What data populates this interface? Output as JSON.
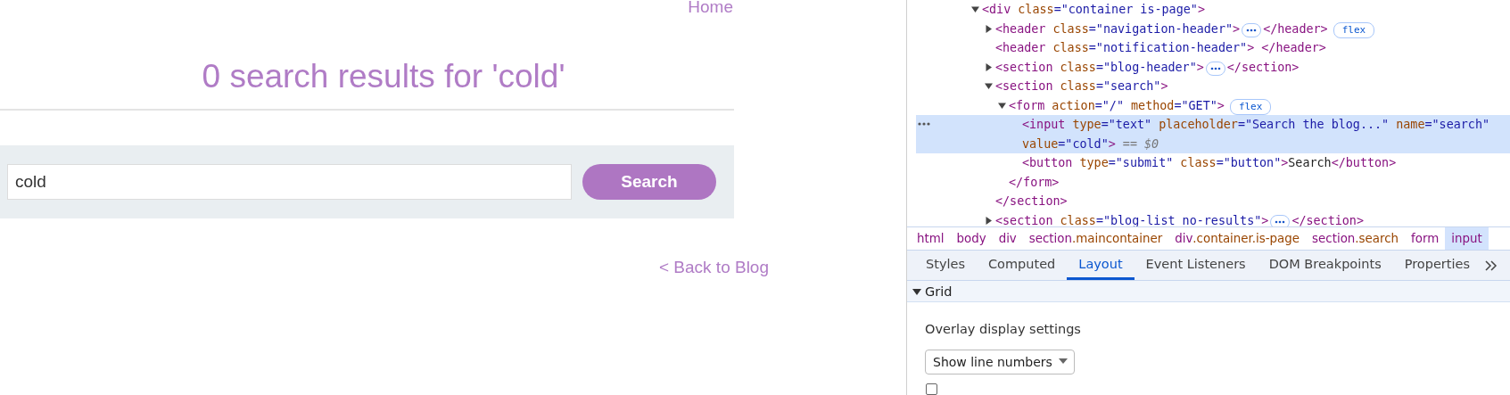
{
  "page": {
    "nav_link": "Home",
    "heading": "0 search results for 'cold'",
    "search": {
      "value": "cold",
      "button": "Search"
    },
    "back_link": "< Back to Blog"
  },
  "devtools": {
    "dom_tree": [
      {
        "open": [
          {
            "kind": "tag",
            "text": "<div"
          },
          {
            "kind": "attr",
            "text": " class"
          },
          {
            "kind": "value",
            "text": "=\"container is-page\""
          },
          {
            "kind": "tag",
            "text": ">"
          }
        ],
        "expanded": true,
        "selected": false,
        "children": [
          {
            "open": [
              {
                "kind": "tag",
                "text": "<header"
              },
              {
                "kind": "attr",
                "text": " class"
              },
              {
                "kind": "value",
                "text": "=\"navigation-header\""
              },
              {
                "kind": "tag",
                "text": ">"
              }
            ],
            "expanded": false,
            "close": [
              {
                "kind": "tag",
                "text": "</header>"
              }
            ],
            "badges": [
              "flex"
            ],
            "selected": false
          },
          {
            "open": [
              {
                "kind": "tag",
                "text": "<header"
              },
              {
                "kind": "attr",
                "text": " class"
              },
              {
                "kind": "value",
                "text": "=\"notification-header\""
              },
              {
                "kind": "tag",
                "text": "> </header>"
              }
            ],
            "selected": false
          },
          {
            "open": [
              {
                "kind": "tag",
                "text": "<section"
              },
              {
                "kind": "attr",
                "text": " class"
              },
              {
                "kind": "value",
                "text": "=\"blog-header\""
              },
              {
                "kind": "tag",
                "text": ">"
              }
            ],
            "expanded": false,
            "close": [
              {
                "kind": "tag",
                "text": "</section>"
              }
            ],
            "selected": false
          },
          {
            "open": [
              {
                "kind": "tag",
                "text": "<section"
              },
              {
                "kind": "attr",
                "text": " class"
              },
              {
                "kind": "value",
                "text": "=\"search\""
              },
              {
                "kind": "tag",
                "text": ">"
              }
            ],
            "expanded": true,
            "close": [
              {
                "kind": "tag",
                "text": "</section>"
              }
            ],
            "selected": false,
            "children": [
              {
                "open": [
                  {
                    "kind": "tag",
                    "text": "<form"
                  },
                  {
                    "kind": "attr",
                    "text": " action"
                  },
                  {
                    "kind": "value",
                    "text": "=\"/\""
                  },
                  {
                    "kind": "attr",
                    "text": " method"
                  },
                  {
                    "kind": "value",
                    "text": "=\"GET\""
                  },
                  {
                    "kind": "tag",
                    "text": ">"
                  }
                ],
                "expanded": true,
                "close": [
                  {
                    "kind": "tag",
                    "text": "</form>"
                  }
                ],
                "badges": [
                  "flex"
                ],
                "selected": false,
                "children": [
                  {
                    "open": [
                      {
                        "kind": "tag",
                        "text": "<input"
                      },
                      {
                        "kind": "attr",
                        "text": " type"
                      },
                      {
                        "kind": "value",
                        "text": "=\"text\""
                      },
                      {
                        "kind": "attr",
                        "text": " placeholder"
                      },
                      {
                        "kind": "value",
                        "text": "=\"Search the blog...\""
                      },
                      {
                        "kind": "attr",
                        "text": " name"
                      },
                      {
                        "kind": "value",
                        "text": "=\"search\""
                      },
                      {
                        "kind": "attr",
                        "text": " value"
                      },
                      {
                        "kind": "value",
                        "text": "=\"cold\""
                      },
                      {
                        "kind": "tag",
                        "text": ">"
                      },
                      {
                        "kind": "ref",
                        "text": " == $0"
                      }
                    ],
                    "selected": true
                  },
                  {
                    "open": [
                      {
                        "kind": "tag",
                        "text": "<button"
                      },
                      {
                        "kind": "attr",
                        "text": " type"
                      },
                      {
                        "kind": "value",
                        "text": "=\"submit\""
                      },
                      {
                        "kind": "attr",
                        "text": " class"
                      },
                      {
                        "kind": "value",
                        "text": "=\"button\""
                      },
                      {
                        "kind": "tag",
                        "text": ">"
                      },
                      {
                        "kind": "text",
                        "text": "Search"
                      },
                      {
                        "kind": "tag",
                        "text": "</button>"
                      }
                    ],
                    "selected": false
                  }
                ]
              }
            ]
          },
          {
            "open": [
              {
                "kind": "tag",
                "text": "<section"
              },
              {
                "kind": "attr",
                "text": " class"
              },
              {
                "kind": "value",
                "text": "=\"blog-list no-results\""
              },
              {
                "kind": "tag",
                "text": ">"
              }
            ],
            "expanded": false,
            "close": [
              {
                "kind": "tag",
                "text": "</section>"
              }
            ],
            "selected": false
          }
        ]
      }
    ],
    "breadcrumbs": [
      {
        "tag": "html",
        "selected": false
      },
      {
        "tag": "body",
        "selected": false
      },
      {
        "tag": "div",
        "selected": false
      },
      {
        "tag": "section",
        "classes": ".maincontainer",
        "selected": false
      },
      {
        "tag": "div",
        "classes": ".container.is-page",
        "selected": false
      },
      {
        "tag": "section",
        "classes": ".search",
        "selected": false
      },
      {
        "tag": "form",
        "selected": false
      },
      {
        "tag": "input",
        "selected": true
      }
    ],
    "tabs": [
      {
        "label": "Styles",
        "selected": false
      },
      {
        "label": "Computed",
        "selected": false
      },
      {
        "label": "Layout",
        "selected": true
      },
      {
        "label": "Event Listeners",
        "selected": false
      },
      {
        "label": "DOM Breakpoints",
        "selected": false
      },
      {
        "label": "Properties",
        "selected": false
      }
    ],
    "layout_pane": {
      "section": {
        "title": "Grid",
        "expanded": true
      },
      "overlay_label": "Overlay display settings",
      "dropdown": {
        "value": "Show line numbers"
      },
      "checkbox": {
        "checked": false
      }
    }
  }
}
